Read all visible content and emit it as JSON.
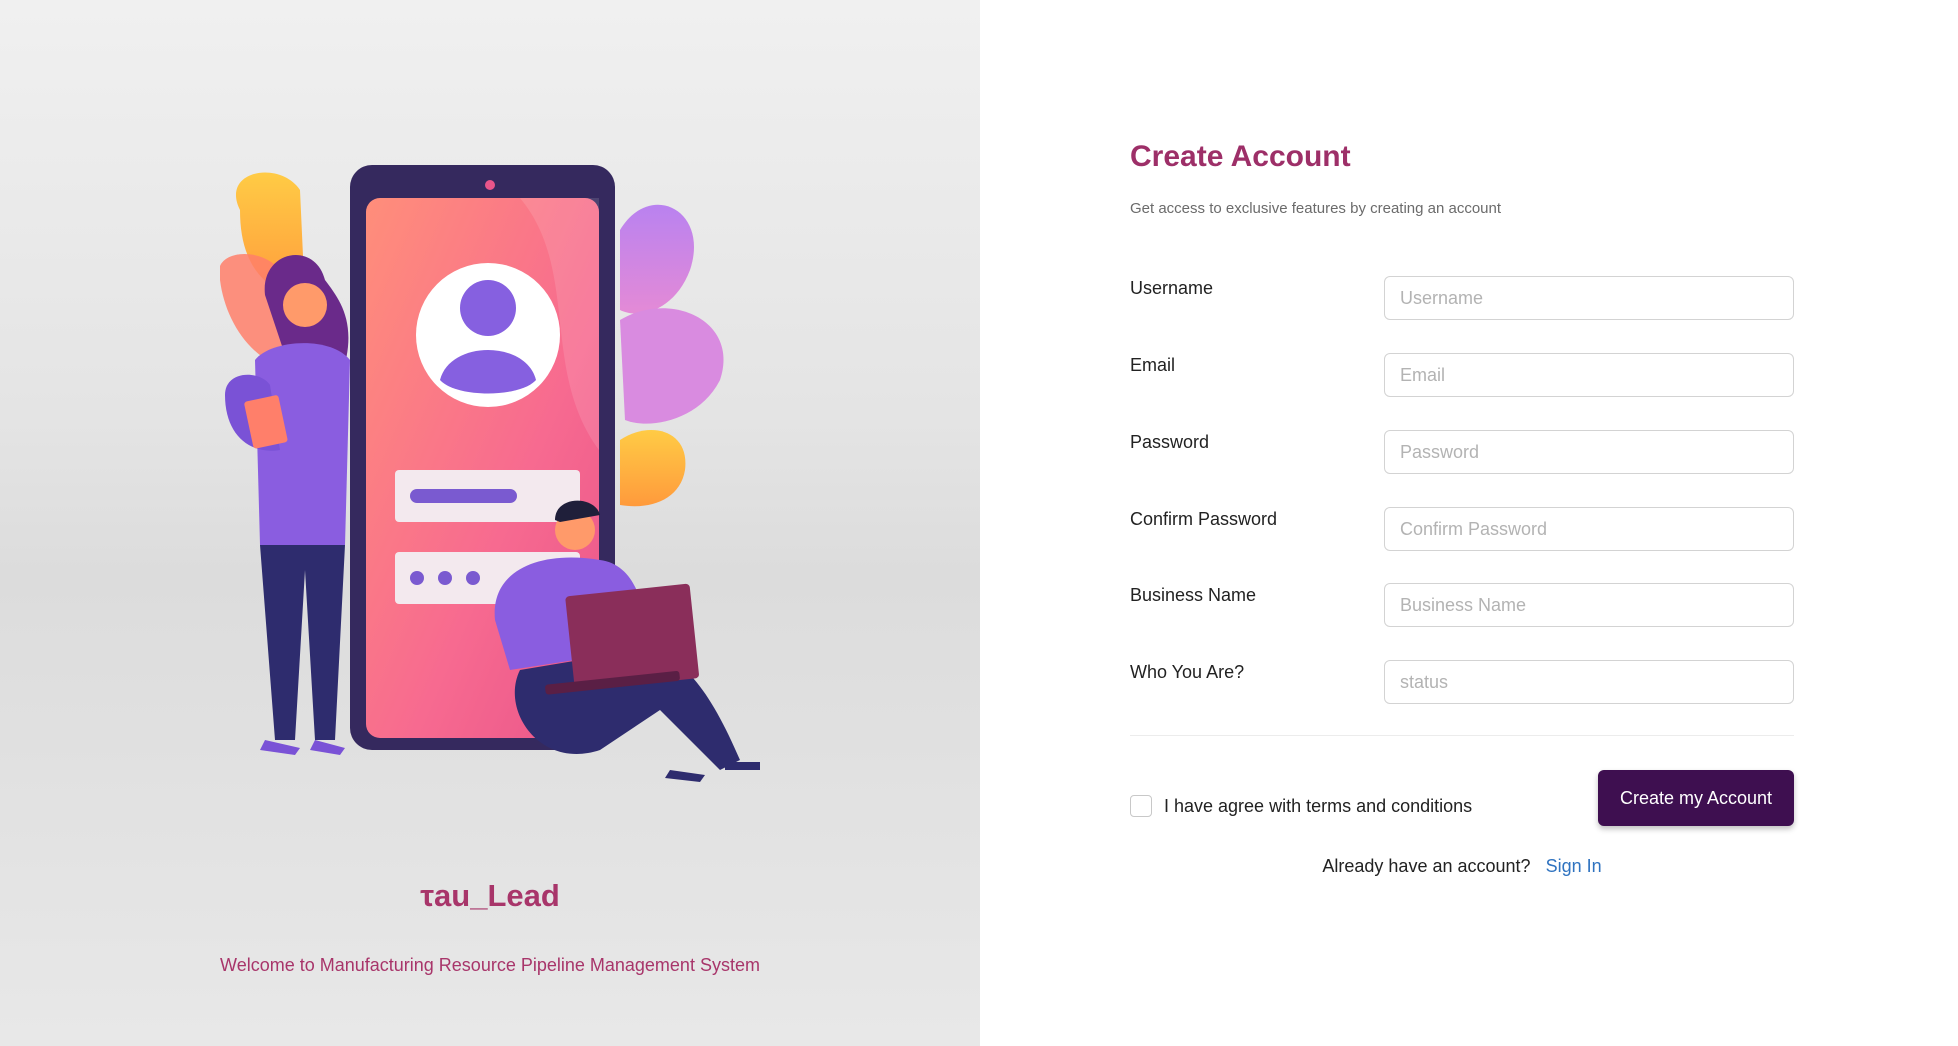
{
  "brand": {
    "name": "τau_Lead",
    "welcome": "Welcome to Manufacturing Resource Pipeline Management System",
    "accent_color": "#a8356a"
  },
  "form": {
    "title": "Create Account",
    "subtitle": "Get access to exclusive features by creating an account",
    "fields": [
      {
        "label": "Username",
        "placeholder": "Username",
        "value": ""
      },
      {
        "label": "Email",
        "placeholder": "Email",
        "value": ""
      },
      {
        "label": "Password",
        "placeholder": "Password",
        "value": ""
      },
      {
        "label": "Confirm Password",
        "placeholder": "Confirm Password",
        "value": ""
      },
      {
        "label": "Business Name",
        "placeholder": "Business Name",
        "value": ""
      },
      {
        "label": "Who You Are?",
        "placeholder": "status",
        "value": ""
      }
    ],
    "terms_label": "I have agree with terms and conditions",
    "terms_checked": false,
    "submit_label": "Create my Account",
    "submit_color": "#3e0f50",
    "signin_prompt": "Already have an account?",
    "signin_link": "Sign In",
    "link_color": "#2f73c0"
  },
  "icons": {
    "illustration": "person-signup-illustration",
    "checkbox": "checkbox-icon"
  }
}
